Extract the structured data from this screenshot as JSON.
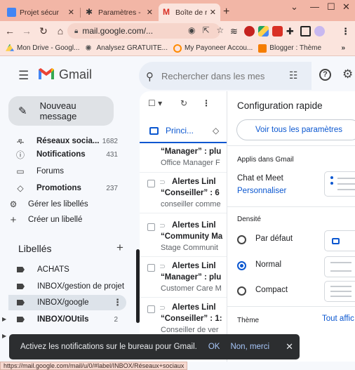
{
  "browser": {
    "tabs": [
      {
        "label": "Projet sécur",
        "active": false
      },
      {
        "label": "Paramètres -",
        "active": false
      },
      {
        "label": "Boîte de réc",
        "active": true
      }
    ],
    "url": "mail.google.com/...",
    "bookmarks": [
      "Mon Drive - Googl...",
      "Analysez GRATUITE...",
      "My Payoneer Accou...",
      "Blogger : Thème"
    ],
    "bookmarks_overflow": "»",
    "status_url": "https://mail.google.com/mail/u/0/#label/INBOX/Réseaux+sociaux"
  },
  "gmail": {
    "brand": "Gmail",
    "search_placeholder": "Rechercher dans les mes",
    "compose_label": "Nouveau message",
    "sidebar": {
      "items": [
        {
          "label": "Réseaux socia...",
          "count": "1682",
          "bold": true
        },
        {
          "label": "Notifications",
          "count": "431",
          "bold": true
        },
        {
          "label": "Forums",
          "count": "",
          "bold": false
        },
        {
          "label": "Promotions",
          "count": "237",
          "bold": true
        },
        {
          "label": "Gérer les libellés",
          "count": "",
          "bold": false
        },
        {
          "label": "Créer un libellé",
          "count": "",
          "bold": false
        }
      ],
      "labels_title": "Libellés",
      "labels": [
        {
          "label": "ACHATS",
          "count": "",
          "bold": false
        },
        {
          "label": "INBOX/gestion de projet",
          "count": "",
          "bold": false
        },
        {
          "label": "INBOX/google",
          "count": "",
          "bold": false,
          "selected": true
        },
        {
          "label": "INBOX/OUtils",
          "count": "2",
          "bold": true
        }
      ]
    },
    "mail_list": {
      "tab_label": "Princi...",
      "rows": [
        {
          "sender": "",
          "subject": "“Manager” : plu",
          "snippet": "Office Manager F"
        },
        {
          "sender": "Alertes Linl",
          "subject": "“Conseiller” : 6",
          "snippet": "conseiller comme"
        },
        {
          "sender": "Alertes Linl",
          "subject": "“Community Ma",
          "snippet": "Stage Communit"
        },
        {
          "sender": "Alertes Linl",
          "subject": "“Manager” : plu",
          "snippet": "Customer Care M"
        },
        {
          "sender": "Alertes Linl",
          "subject": "“Conseiller” : 1:",
          "snippet": "Conseiller de ver"
        }
      ]
    },
    "quick_settings": {
      "title": "Configuration rapide",
      "all_settings": "Voir tous les paramètres",
      "apps_section": "Applis dans Gmail",
      "chat_meet": "Chat et Meet",
      "customize": "Personnaliser",
      "density_section": "Densité",
      "density_options": [
        "Par défaut",
        "Normal",
        "Compact"
      ],
      "density_selected": "Normal",
      "theme_section": "Thème",
      "theme_link": "Tout affic"
    },
    "snackbar": {
      "message": "Activez les notifications sur le bureau pour Gmail.",
      "ok": "OK",
      "no": "Non, merci"
    }
  }
}
